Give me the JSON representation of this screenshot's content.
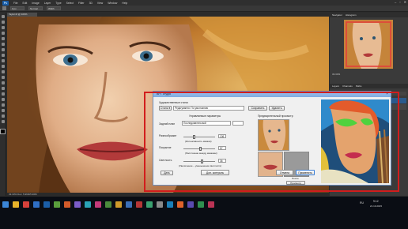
{
  "menubar": {
    "logo": "Ps",
    "items": [
      "File",
      "Edit",
      "Image",
      "Layer",
      "Type",
      "Select",
      "Filter",
      "3D",
      "View",
      "Window",
      "Help"
    ]
  },
  "optbar": {
    "field1": "0 px",
    "field2": "Normal",
    "field3": "Width"
  },
  "document_tab": "Taylor.tif @ 100% (RGB/8#)",
  "status_text": "33.33%   Doc: 5.96M/5.96M",
  "panels": {
    "top_tabs": [
      "Navigator",
      "Histogram"
    ],
    "zoom_label": "33.33%",
    "layer_tabs": [
      "Layers",
      "Channels",
      "Paths"
    ],
    "layer_names": [
      "Layer 1",
      "Background"
    ]
  },
  "dialog": {
    "title": "BPT студія",
    "section_presets": "Художественные стили",
    "preset_button": "Стиль ▾",
    "preset_name": "Редагування: По умолчанию",
    "save_button": "Сохранить",
    "delete_button": "Удалить",
    "controls_title": "Управляемые параметры",
    "preview_title": "Предварительный просмотр",
    "mode_label": "Задний план",
    "mode_value": "Последовательный",
    "detail_label": "Разнообразие",
    "detail_value": "136",
    "detail_hint": "(Интенсивность мазков)",
    "density_label": "Покрытие",
    "density_value": "57",
    "density_hint": "(Расстояние между мазками)",
    "sharp_label": "Светлость",
    "sharp_value": "36",
    "sharp_hint": "(Увеличение – уменьшение светлости)",
    "apply_button": "Дать",
    "after_label": "После",
    "preview_button": "Просмотр",
    "more_button": "Доп. контроль",
    "cancel_button": "Отмена",
    "ok_button": "Применить"
  },
  "taskbar": {
    "lang": "RU",
    "time": "9:12",
    "date": "21.10.2015"
  },
  "colors": {
    "accent_red": "#d21d1d",
    "dialog_title": "#8db7ea",
    "ps_blue": "#1b5ea8"
  }
}
